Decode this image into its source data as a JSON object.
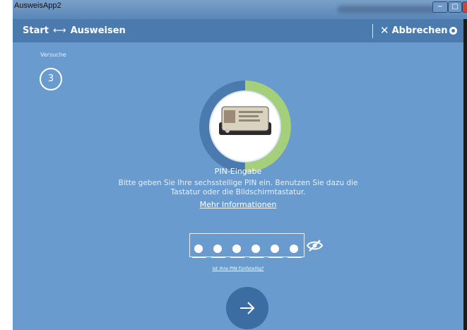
{
  "window": {
    "title": "AusweisApp2",
    "controls": {
      "minimize": "−",
      "maximize": "□",
      "close": "×"
    }
  },
  "header": {
    "breadcrumb": {
      "start": "Start",
      "arrow": "⟷",
      "current": "Ausweisen"
    },
    "cancel_label": "Abbrechen",
    "settings_icon": "gear-icon"
  },
  "attempts": {
    "label": "Versuche",
    "count": "3"
  },
  "status": {
    "progress_fraction": 0.5,
    "ring_color": "#a6cf7c",
    "track_color": "#4b7aae"
  },
  "pin": {
    "title": "PIN-Eingabe",
    "description": "Bitte geben Sie Ihre sechsstellige PIN ein. Benutzen Sie dazu die Tastatur oder die Bildschirmtastatur.",
    "more_info": "Mehr Informationen",
    "entered_digits": 6,
    "total_digits": 6,
    "visibility_icon": "eye-off-icon",
    "five_digit_link": "Ist Ihre PIN fünfstellig?"
  },
  "next_button": {
    "icon": "arrow-right-icon"
  },
  "colors": {
    "background": "#6a9bcf",
    "header": "#4b7aae",
    "button": "#3b6ca2",
    "accent": "#a6cf7c"
  }
}
